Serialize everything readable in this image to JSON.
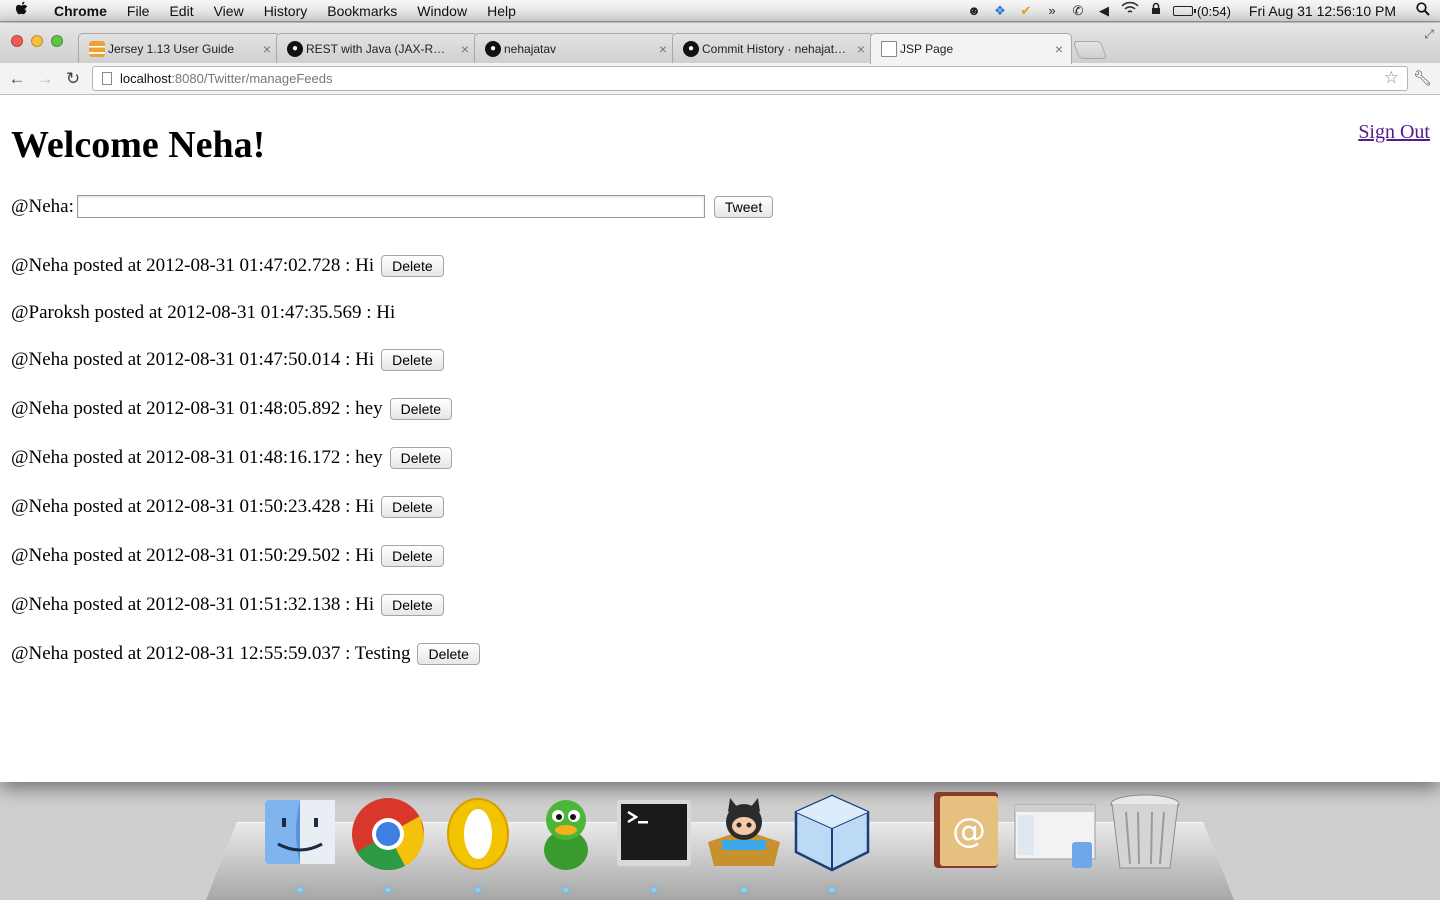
{
  "menubar": {
    "app_name": "Chrome",
    "items": [
      "File",
      "Edit",
      "View",
      "History",
      "Bookmarks",
      "Window",
      "Help"
    ],
    "battery_text": "(0:54)",
    "clock": "Fri Aug 31  12:56:10 PM"
  },
  "tabs": [
    {
      "title": "Jersey 1.13 User Guide",
      "favicon": "jersey-favicon",
      "active": false
    },
    {
      "title": "REST with Java (JAX-RS) using",
      "favicon": "github-favicon",
      "active": false
    },
    {
      "title": "nehajatav",
      "favicon": "github-favicon",
      "active": false
    },
    {
      "title": "Commit History · nehajatav/",
      "favicon": "github-favicon",
      "active": false
    },
    {
      "title": "JSP Page",
      "favicon": "page-favicon",
      "active": true
    }
  ],
  "address_bar": {
    "host": "localhost",
    "rest": ":8080/Twitter/manageFeeds"
  },
  "page": {
    "heading": "Welcome Neha!",
    "sign_out": "Sign Out",
    "handle_label": "@Neha:",
    "tweet_value": "",
    "tweet_button": "Tweet",
    "delete_label": "Delete",
    "posts": [
      {
        "text": "@Neha posted at 2012-08-31 01:47:02.728 : Hi",
        "deletable": true
      },
      {
        "text": "@Paroksh posted at 2012-08-31 01:47:35.569 : Hi",
        "deletable": false
      },
      {
        "text": "@Neha posted at 2012-08-31 01:47:50.014 : Hi",
        "deletable": true
      },
      {
        "text": "@Neha posted at 2012-08-31 01:48:05.892 : hey",
        "deletable": true
      },
      {
        "text": "@Neha posted at 2012-08-31 01:48:16.172 : hey",
        "deletable": true
      },
      {
        "text": "@Neha posted at 2012-08-31 01:50:23.428 : Hi",
        "deletable": true
      },
      {
        "text": "@Neha posted at 2012-08-31 01:50:29.502 : Hi",
        "deletable": true
      },
      {
        "text": "@Neha posted at 2012-08-31 01:51:32.138 : Hi",
        "deletable": true
      },
      {
        "text": "@Neha posted at 2012-08-31 12:55:59.037 : Testing",
        "deletable": true
      }
    ]
  },
  "dock": [
    {
      "name": "finder-icon",
      "running": true
    },
    {
      "name": "chrome-icon",
      "running": true
    },
    {
      "name": "opera-icon",
      "running": true
    },
    {
      "name": "adium-icon",
      "running": true
    },
    {
      "name": "terminal-icon",
      "running": true
    },
    {
      "name": "github-app-icon",
      "running": true
    },
    {
      "name": "virtualbox-icon",
      "running": true
    },
    {
      "name": "address-book-icon",
      "running": false
    },
    {
      "name": "finder-window-icon",
      "running": false
    },
    {
      "name": "trash-icon",
      "running": false
    }
  ],
  "colors": {
    "visited_link": "#551a8b",
    "dock_indicator": "#7fd4ff"
  }
}
